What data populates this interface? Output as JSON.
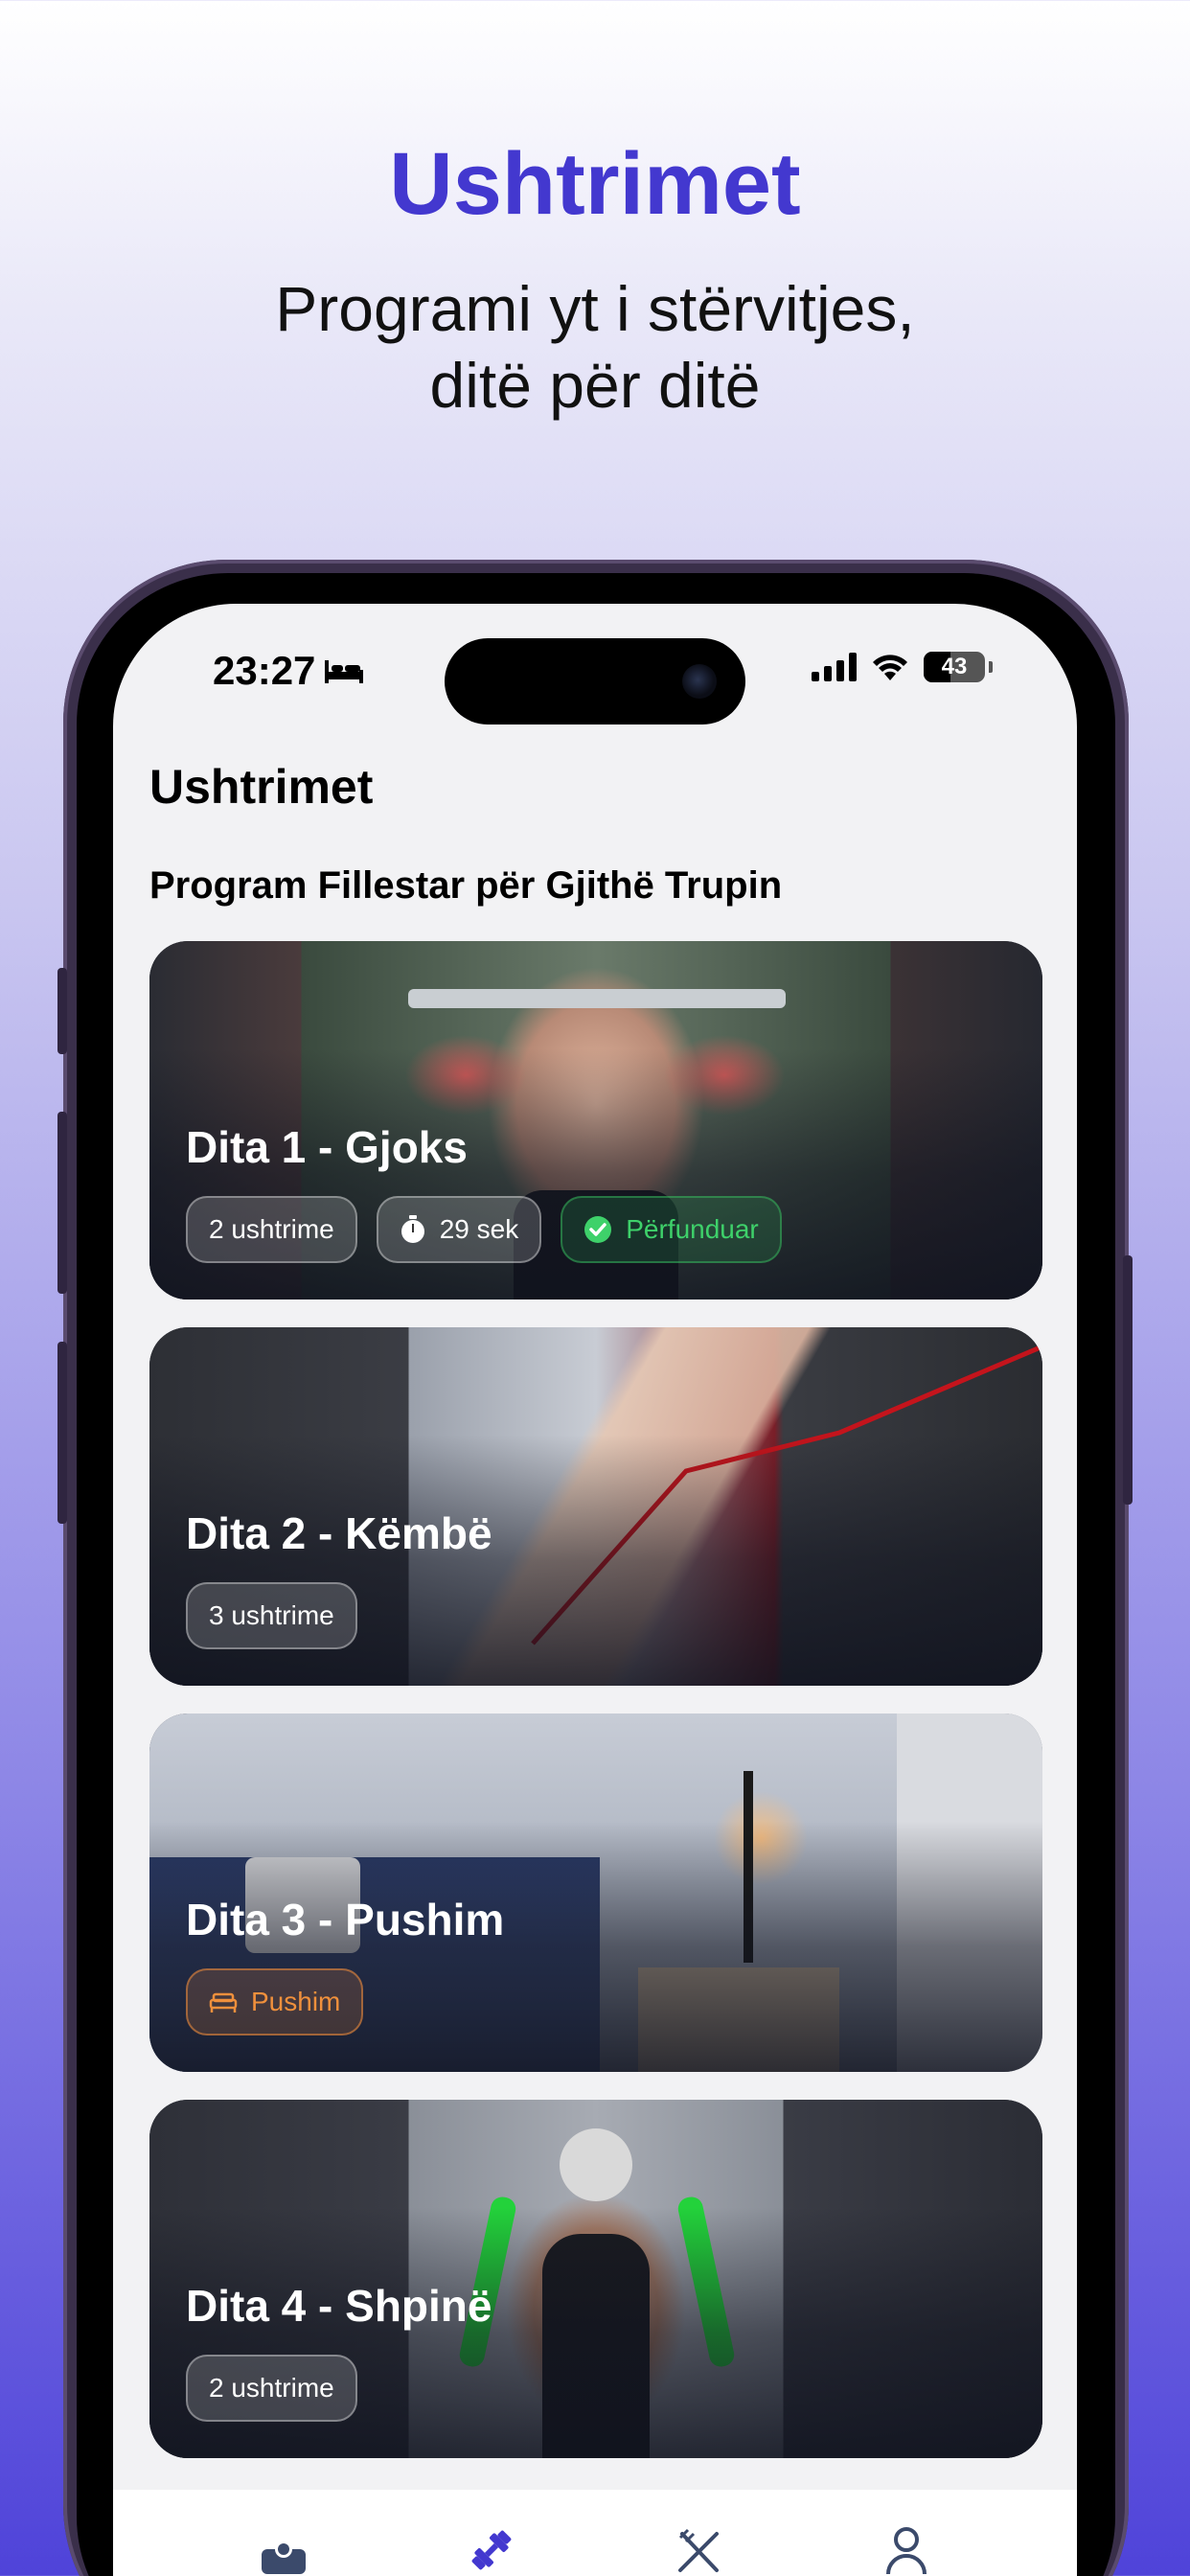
{
  "hero": {
    "title": "Ushtrimet",
    "subtitle_line1": "Programi yt i stërvitjes,",
    "subtitle_line2": "ditë për ditë"
  },
  "status_bar": {
    "time": "23:27",
    "battery": "43",
    "icons": [
      "bed-icon",
      "signal-icon",
      "wifi-icon",
      "battery-icon"
    ]
  },
  "app": {
    "title": "Ushtrimet",
    "section_title": "Program Fillestar për Gjithë Trupin"
  },
  "cards": [
    {
      "title": "Dita 1 - Gjoks",
      "exercises": "2 ushtrime",
      "duration": "29 sek",
      "status": "Përfunduar"
    },
    {
      "title": "Dita 2 - Këmbë",
      "exercises": "3 ushtrime"
    },
    {
      "title": "Dita 3 - Pushim",
      "rest_label": "Pushim"
    },
    {
      "title": "Dita 4 - Shpinë",
      "exercises": "2 ushtrime"
    }
  ],
  "tabbar": {
    "items": [
      "home-icon",
      "workout-icon",
      "nutrition-icon",
      "profile-icon"
    ],
    "active": "workout-icon"
  },
  "colors": {
    "accent": "#4338cf",
    "done_green": "#3ed16a",
    "rest_orange": "#f0903c",
    "tab_inactive": "#3b4a6b"
  }
}
